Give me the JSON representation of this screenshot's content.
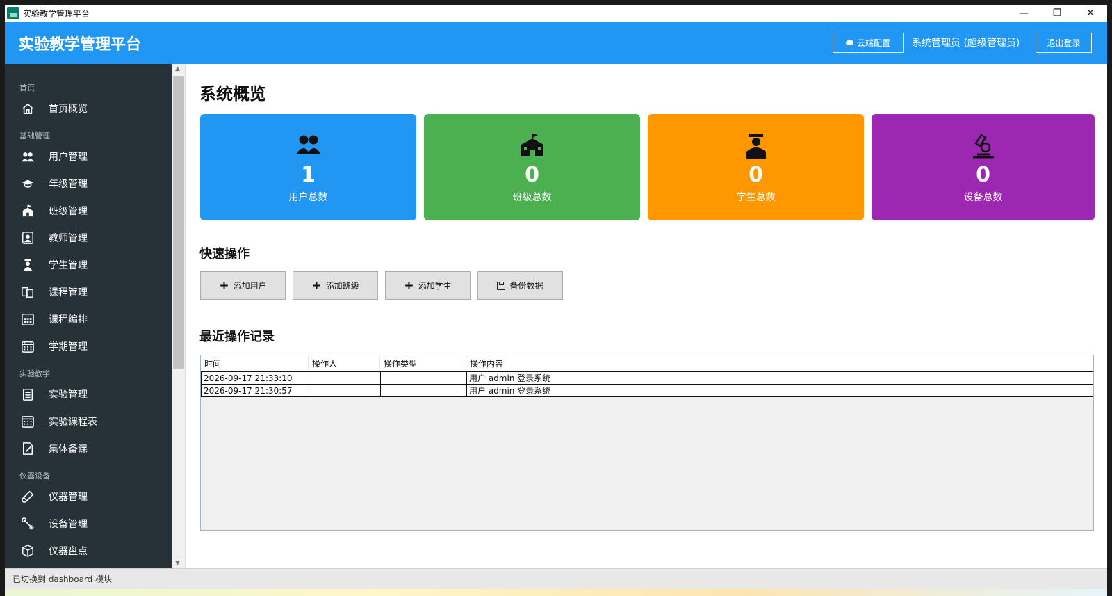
{
  "window": {
    "title": "实验教学管理平台",
    "controls": {
      "minimize": "—",
      "restore": "❐",
      "close": "✕"
    }
  },
  "header": {
    "title": "实验教学管理平台",
    "cloud_button": "云端配置",
    "user_label": "系统管理员 (超级管理员)",
    "logout_button": "退出登录",
    "color": "#2196f3"
  },
  "sidebar": {
    "sections": [
      {
        "label": "首页",
        "items": [
          {
            "label": "首页概览",
            "icon": "home-icon"
          }
        ]
      },
      {
        "label": "基础管理",
        "items": [
          {
            "label": "用户管理",
            "icon": "users-icon"
          },
          {
            "label": "年级管理",
            "icon": "graduation-cap-icon"
          },
          {
            "label": "班级管理",
            "icon": "school-icon"
          },
          {
            "label": "教师管理",
            "icon": "teacher-icon"
          },
          {
            "label": "学生管理",
            "icon": "student-icon"
          },
          {
            "label": "课程管理",
            "icon": "course-icon"
          },
          {
            "label": "课程编排",
            "icon": "schedule-icon"
          },
          {
            "label": "学期管理",
            "icon": "calendar-icon"
          }
        ]
      },
      {
        "label": "实验教学",
        "items": [
          {
            "label": "实验管理",
            "icon": "clipboard-icon"
          },
          {
            "label": "实验课程表",
            "icon": "timetable-icon"
          },
          {
            "label": "集体备课",
            "icon": "edit-document-icon"
          }
        ]
      },
      {
        "label": "仪器设备",
        "items": [
          {
            "label": "仪器管理",
            "icon": "test-tube-icon"
          },
          {
            "label": "设备管理",
            "icon": "wrench-icon"
          },
          {
            "label": "仪器盘点",
            "icon": "box-icon"
          }
        ]
      }
    ],
    "background": "#263238"
  },
  "main": {
    "title": "系统概览",
    "stats": [
      {
        "label": "用户总数",
        "value": "1",
        "icon": "users-icon",
        "color": "#2196f3"
      },
      {
        "label": "班级总数",
        "value": "0",
        "icon": "school-icon",
        "color": "#4caf50"
      },
      {
        "label": "学生总数",
        "value": "0",
        "icon": "student-icon",
        "color": "#ff9800"
      },
      {
        "label": "设备总数",
        "value": "0",
        "icon": "microscope-icon",
        "color": "#9c27b0"
      }
    ],
    "quick_title": "快速操作",
    "quick_actions": [
      {
        "label": "添加用户",
        "icon": "plus-icon"
      },
      {
        "label": "添加班级",
        "icon": "plus-icon"
      },
      {
        "label": "添加学生",
        "icon": "plus-icon"
      },
      {
        "label": "备份数据",
        "icon": "save-icon"
      }
    ],
    "log_title": "最近操作记录",
    "log_columns": [
      "时间",
      "操作人",
      "操作类型",
      "操作内容"
    ],
    "log_rows": [
      [
        "2026-09-17 21:33:10",
        "",
        "",
        "用户 admin 登录系统"
      ],
      [
        "2026-09-17 21:30:57",
        "",
        "",
        "用户 admin 登录系统"
      ]
    ]
  },
  "status_bar": {
    "text": "已切换到 dashboard 模块"
  }
}
